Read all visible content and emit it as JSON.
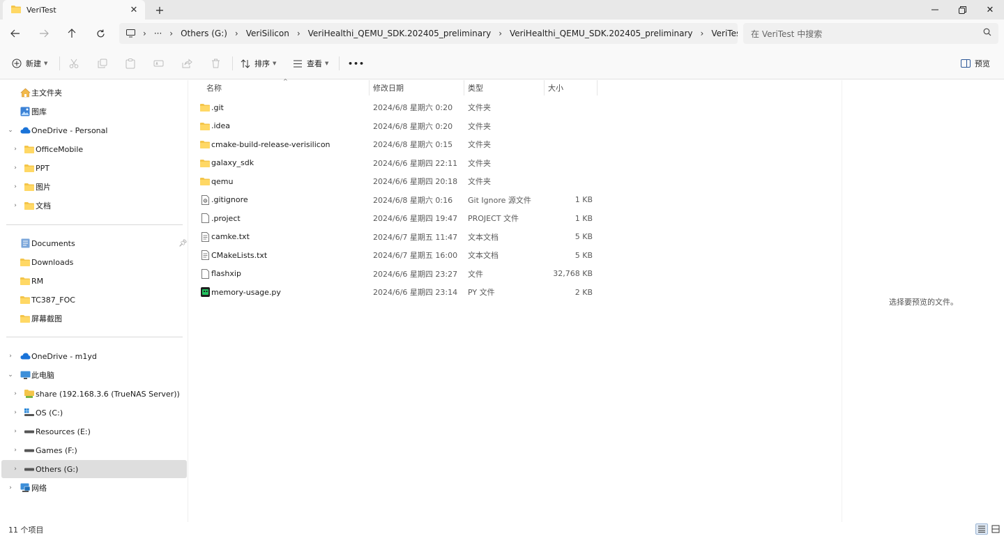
{
  "window": {
    "tab_title": "VeriTest",
    "new_tab_icon": "plus-icon",
    "controls": [
      "minimize",
      "restore",
      "close"
    ]
  },
  "address": {
    "crumbs": [
      "Others (G:)",
      "VeriSilicon",
      "VeriHealthi_QEMU_SDK.202405_preliminary",
      "VeriHealthi_QEMU_SDK.202405_preliminary",
      "VeriTest"
    ],
    "overflow": "···",
    "search_placeholder": "在 VeriTest 中搜索"
  },
  "toolbar": {
    "new_label": "新建",
    "sort_label": "排序",
    "view_label": "查看",
    "more_label": "•••",
    "preview_label": "预览"
  },
  "sidebar": {
    "quick": [
      {
        "label": "主文件夹",
        "icon": "home-icon"
      },
      {
        "label": "图库",
        "icon": "gallery-icon"
      }
    ],
    "onedrive_personal": {
      "label": "OneDrive - Personal",
      "icon": "cloud-icon"
    },
    "onedrive_children": [
      {
        "label": "OfficeMobile"
      },
      {
        "label": "PPT"
      },
      {
        "label": "图片"
      },
      {
        "label": "文档"
      }
    ],
    "pinned": [
      {
        "label": "Documents",
        "icon": "documents-icon"
      },
      {
        "label": "Downloads",
        "icon": "folder-icon"
      },
      {
        "label": "RM",
        "icon": "folder-icon"
      },
      {
        "label": "TC387_FOC",
        "icon": "folder-icon"
      },
      {
        "label": "屏幕截图",
        "icon": "folder-icon"
      }
    ],
    "onedrive_m1yd": {
      "label": "OneDrive - m1yd",
      "icon": "cloud-icon"
    },
    "this_pc": {
      "label": "此电脑",
      "icon": "computer-icon"
    },
    "drives": [
      {
        "label": "share (192.168.3.6 (TrueNAS Server))",
        "icon": "network-drive-icon"
      },
      {
        "label": "OS (C:)",
        "icon": "system-drive-icon"
      },
      {
        "label": "Resources (E:)",
        "icon": "drive-icon"
      },
      {
        "label": "Games (F:)",
        "icon": "drive-icon"
      },
      {
        "label": "Others (G:)",
        "icon": "drive-icon"
      }
    ],
    "network": {
      "label": "网络",
      "icon": "network-icon"
    }
  },
  "columns": {
    "name": "名称",
    "date": "修改日期",
    "type": "类型",
    "size": "大小"
  },
  "files": [
    {
      "name": ".git",
      "date": "2024/6/8 星期六 0:20",
      "type": "文件夹",
      "size": "",
      "icon": "folder-icon"
    },
    {
      "name": ".idea",
      "date": "2024/6/8 星期六 0:20",
      "type": "文件夹",
      "size": "",
      "icon": "folder-icon"
    },
    {
      "name": "cmake-build-release-verisilicon",
      "date": "2024/6/8 星期六 0:15",
      "type": "文件夹",
      "size": "",
      "icon": "folder-icon"
    },
    {
      "name": "galaxy_sdk",
      "date": "2024/6/6 星期四 22:11",
      "type": "文件夹",
      "size": "",
      "icon": "folder-icon"
    },
    {
      "name": "qemu",
      "date": "2024/6/6 星期四 20:18",
      "type": "文件夹",
      "size": "",
      "icon": "folder-icon"
    },
    {
      "name": ".gitignore",
      "date": "2024/6/8 星期六 0:16",
      "type": "Git Ignore 源文件",
      "size": "1 KB",
      "icon": "gear-file-icon"
    },
    {
      "name": ".project",
      "date": "2024/6/6 星期四 19:47",
      "type": "PROJECT 文件",
      "size": "1 KB",
      "icon": "file-icon"
    },
    {
      "name": "camke.txt",
      "date": "2024/6/7 星期五 11:47",
      "type": "文本文档",
      "size": "5 KB",
      "icon": "text-file-icon"
    },
    {
      "name": "CMakeLists.txt",
      "date": "2024/6/7 星期五 16:00",
      "type": "文本文档",
      "size": "5 KB",
      "icon": "text-file-icon"
    },
    {
      "name": "flashxip",
      "date": "2024/6/6 星期四 23:27",
      "type": "文件",
      "size": "32,768 KB",
      "icon": "file-icon"
    },
    {
      "name": "memory-usage.py",
      "date": "2024/6/6 星期四 23:14",
      "type": "PY 文件",
      "size": "2 KB",
      "icon": "python-file-icon"
    }
  ],
  "preview": {
    "message": "选择要预览的文件。"
  },
  "status": {
    "count": "11 个项目"
  }
}
